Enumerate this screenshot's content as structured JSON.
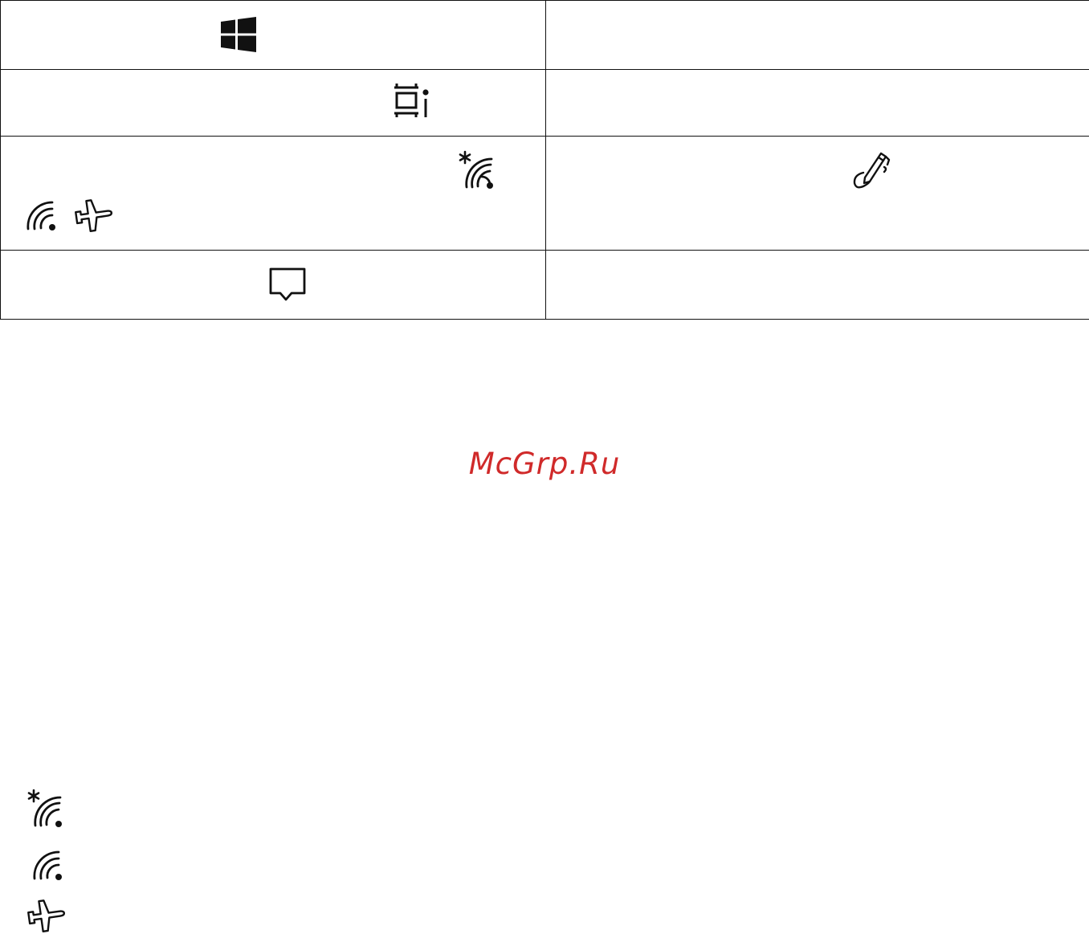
{
  "watermark": {
    "text": "McGrp.Ru",
    "color": "#d02a2a"
  },
  "icon_table": {
    "rows": [
      {
        "left_icons": [
          "windows-logo-icon"
        ],
        "right_icons": []
      },
      {
        "left_icons": [
          "task-view-icon"
        ],
        "right_icons": []
      },
      {
        "left_icons": [
          "wireless-bluetooth-icon",
          "wifi-icon",
          "airplane-icon"
        ],
        "right_icons": [
          "pen-icon"
        ]
      },
      {
        "left_icons": [
          "action-center-icon"
        ],
        "right_icons": []
      }
    ]
  },
  "legend_icons": [
    "wireless-bluetooth-icon",
    "wifi-icon",
    "airplane-icon"
  ]
}
